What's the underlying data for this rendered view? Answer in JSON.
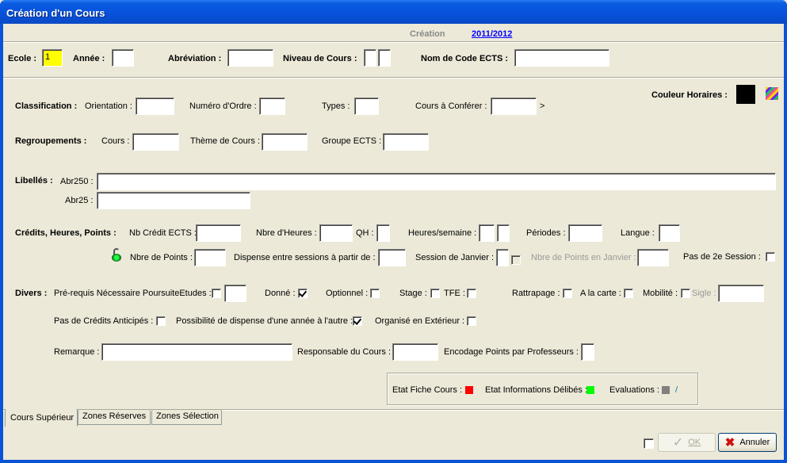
{
  "window": {
    "title": "Création d'un Cours"
  },
  "header": {
    "mode": "Création",
    "year_link": "2011/2012"
  },
  "top_row": {
    "ecole_label": "Ecole :",
    "ecole_value": "1",
    "annee_label": "Année :",
    "annee_value": "",
    "abreviation_label": "Abréviation :",
    "abreviation_value": "",
    "niveau_label": "Niveau de Cours :",
    "niveau_value_1": "",
    "niveau_value_2": "",
    "ects_code_label": "Nom de Code ECTS :",
    "ects_code_value": ""
  },
  "couleur": {
    "label": "Couleur Horaires :",
    "color": "#000000"
  },
  "classification": {
    "label": "Classification :",
    "orientation_label": "Orientation :",
    "numero_label": "Numéro d'Ordre :",
    "types_label": "Types :",
    "conferer_label": "Cours à Conférer :",
    "conferer_suffix": ">"
  },
  "regroupements": {
    "label": "Regroupements :",
    "cours_label": "Cours :",
    "theme_label": "Thème de Cours :",
    "groupe_label": "Groupe ECTS :"
  },
  "libelles": {
    "label": "Libellés :",
    "abr250_label": "Abr250 :",
    "abr250_value": "",
    "abr25_label": "Abr25 :",
    "abr25_value": ""
  },
  "credits": {
    "label": "Crédits, Heures, Points :",
    "ects_label": "Nb Crédit ECTS :",
    "heures_label": "Nbre d'Heures :",
    "qh_label": "QH :",
    "hsem_label": "Heures/semaine :",
    "periodes_label": "Périodes :",
    "langue_label": "Langue :",
    "points_label": "Nbre de Points :",
    "dispense_label": "Dispense entre sessions à partir de :",
    "janvier_label": "Session de Janvier :",
    "points_janvier_label": "Nbre de Points en Janvier :",
    "pas2e_label": "Pas de 2e Session :",
    "pas2e_checked": false
  },
  "divers": {
    "label": "Divers :",
    "prerequis_label": "Pré-requis Nécessaire PoursuiteEtudes :",
    "prerequis_checked": false,
    "donne_label": "Donné :",
    "donne_checked": true,
    "optionnel_label": "Optionnel :",
    "optionnel_checked": false,
    "stage_label": "Stage :",
    "stage_checked": false,
    "tfe_label": "TFE :",
    "tfe_checked": false,
    "rattrapage_label": "Rattrapage :",
    "rattrapage_checked": false,
    "carte_label": "A la carte :",
    "carte_checked": false,
    "mobilite_label": "Mobilité :",
    "mobilite_checked": false,
    "sigle_label": "Sigle :",
    "pas_credits_label": "Pas de Crédits Anticipés :",
    "pas_credits_checked": false,
    "possibilite_label": "Possibilité de dispense d'une année à l'autre :",
    "possibilite_checked": true,
    "organise_label": "Organisé en Extérieur :",
    "organise_checked": false,
    "remarque_label": "Remarque :",
    "remarque_value": "",
    "responsable_label": "Responsable du Cours :",
    "responsable_value": "",
    "encodage_label": "Encodage Points par Professeurs :"
  },
  "status": {
    "fiche_label": "Etat Fiche Cours :",
    "fiche_color": "#ff0000",
    "delibes_label": "Etat Informations Délibés :",
    "delibes_color": "#00ff00",
    "evaluations_label": "Evaluations :",
    "evaluations_color": "#808080",
    "evaluations_suffix": "/"
  },
  "tabs": [
    {
      "label": "Cours Supérieur",
      "active": true
    },
    {
      "label": "Zones Réserves",
      "active": false
    },
    {
      "label": "Zones Sélection",
      "active": false
    }
  ],
  "footer": {
    "ok_label": "OK",
    "cancel_label": "Annuler"
  }
}
